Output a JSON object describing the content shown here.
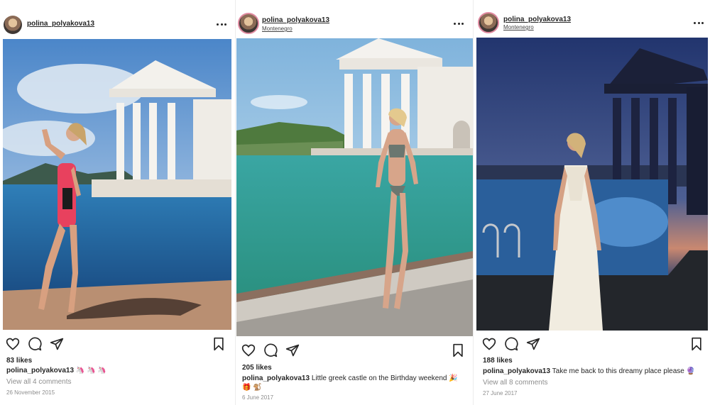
{
  "posts": [
    {
      "username": "polina_polyakova13",
      "location": "",
      "likes": "83 likes",
      "caption_user": "polina_polyakova13",
      "caption_text": " 🦄 🦄 🦄",
      "comments": "View all 4 comments",
      "date": "26 November 2015",
      "photo_description_icon": "photo-pool-pink-swimsuit"
    },
    {
      "username": "polina_polyakova13",
      "location": "Montenegro",
      "likes": "205 likes",
      "caption_user": "polina_polyakova13",
      "caption_text": " Little greek castle on the Birthday weekend 🎉 🎁 🐒",
      "comments": "",
      "date": "6 June 2017",
      "photo_description_icon": "photo-pool-bikini"
    },
    {
      "username": "polina_polyakova13",
      "location": "Montenegro",
      "likes": "188 likes",
      "caption_user": "polina_polyakova13",
      "caption_text": " Take me back to this dreamy place please 🔮",
      "comments": "View all 8 comments",
      "date": "27 June 2017",
      "photo_description_icon": "photo-pool-night-white-dress"
    }
  ],
  "icons": {
    "like": "heart-icon",
    "comment": "comment-icon",
    "share": "share-icon",
    "save": "bookmark-icon",
    "more": "more-options-icon"
  },
  "colors": {
    "text": "#262626",
    "muted": "#8e8e8e",
    "story_ring": "#e08aa0"
  }
}
